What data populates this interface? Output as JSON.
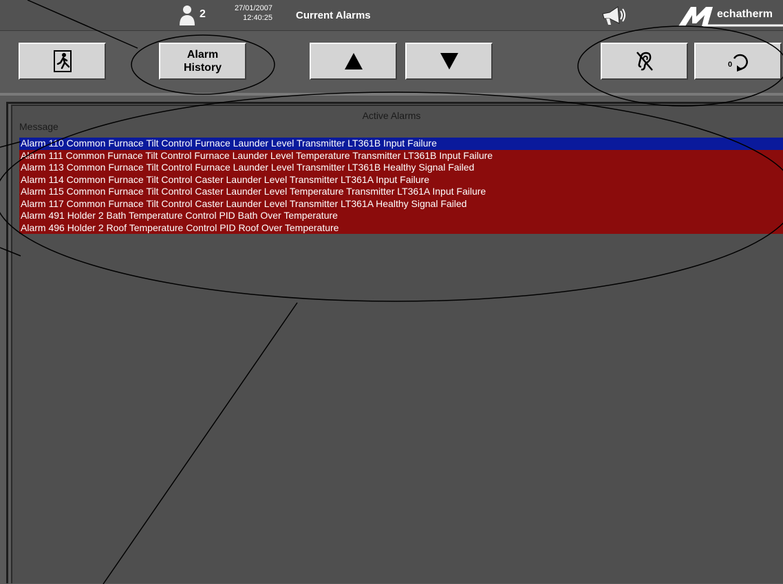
{
  "header": {
    "user_count": "2",
    "date": "27/01/2007",
    "time": "12:40:25",
    "title": "Current Alarms",
    "brand": "echatherm"
  },
  "toolbar": {
    "exit_icon": "exit-running-man-icon",
    "history_label": "Alarm\nHistory",
    "up_icon": "triangle-up-icon",
    "down_icon": "triangle-down-icon",
    "silence_icon": "ear-silence-icon",
    "reset_icon": "reset-refresh-icon"
  },
  "alarms_panel": {
    "title": "Active Alarms",
    "column_header": "Message",
    "rows": [
      "Alarm 110 Common Furnace Tilt Control Furnace Launder Level Transmitter LT361B Input Failure",
      "Alarm 111 Common Furnace Tilt Control Furnace Launder Level Temperature Transmitter LT361B Input Failure",
      "Alarm 113 Common Furnace Tilt Control Furnace Launder Level Transmitter LT361B Healthy Signal Failed",
      "Alarm 114 Common Furnace Tilt Control Caster Launder Level Transmitter LT361A Input Failure",
      "Alarm 115 Common Furnace Tilt Control Caster Launder Level Temperature Transmitter LT361A Input Failure",
      "Alarm 117 Common Furnace Tilt Control Caster Launder Level Transmitter LT361A Healthy Signal Failed",
      "Alarm 491 Holder 2 Bath Temperature Control PID Bath Over Temperature",
      "Alarm 496 Holder 2 Roof Temperature Control PID Roof Over Temperature"
    ],
    "selected_row_color": "#0a1a9c",
    "alarm_row_color": "#8b0c0c"
  }
}
